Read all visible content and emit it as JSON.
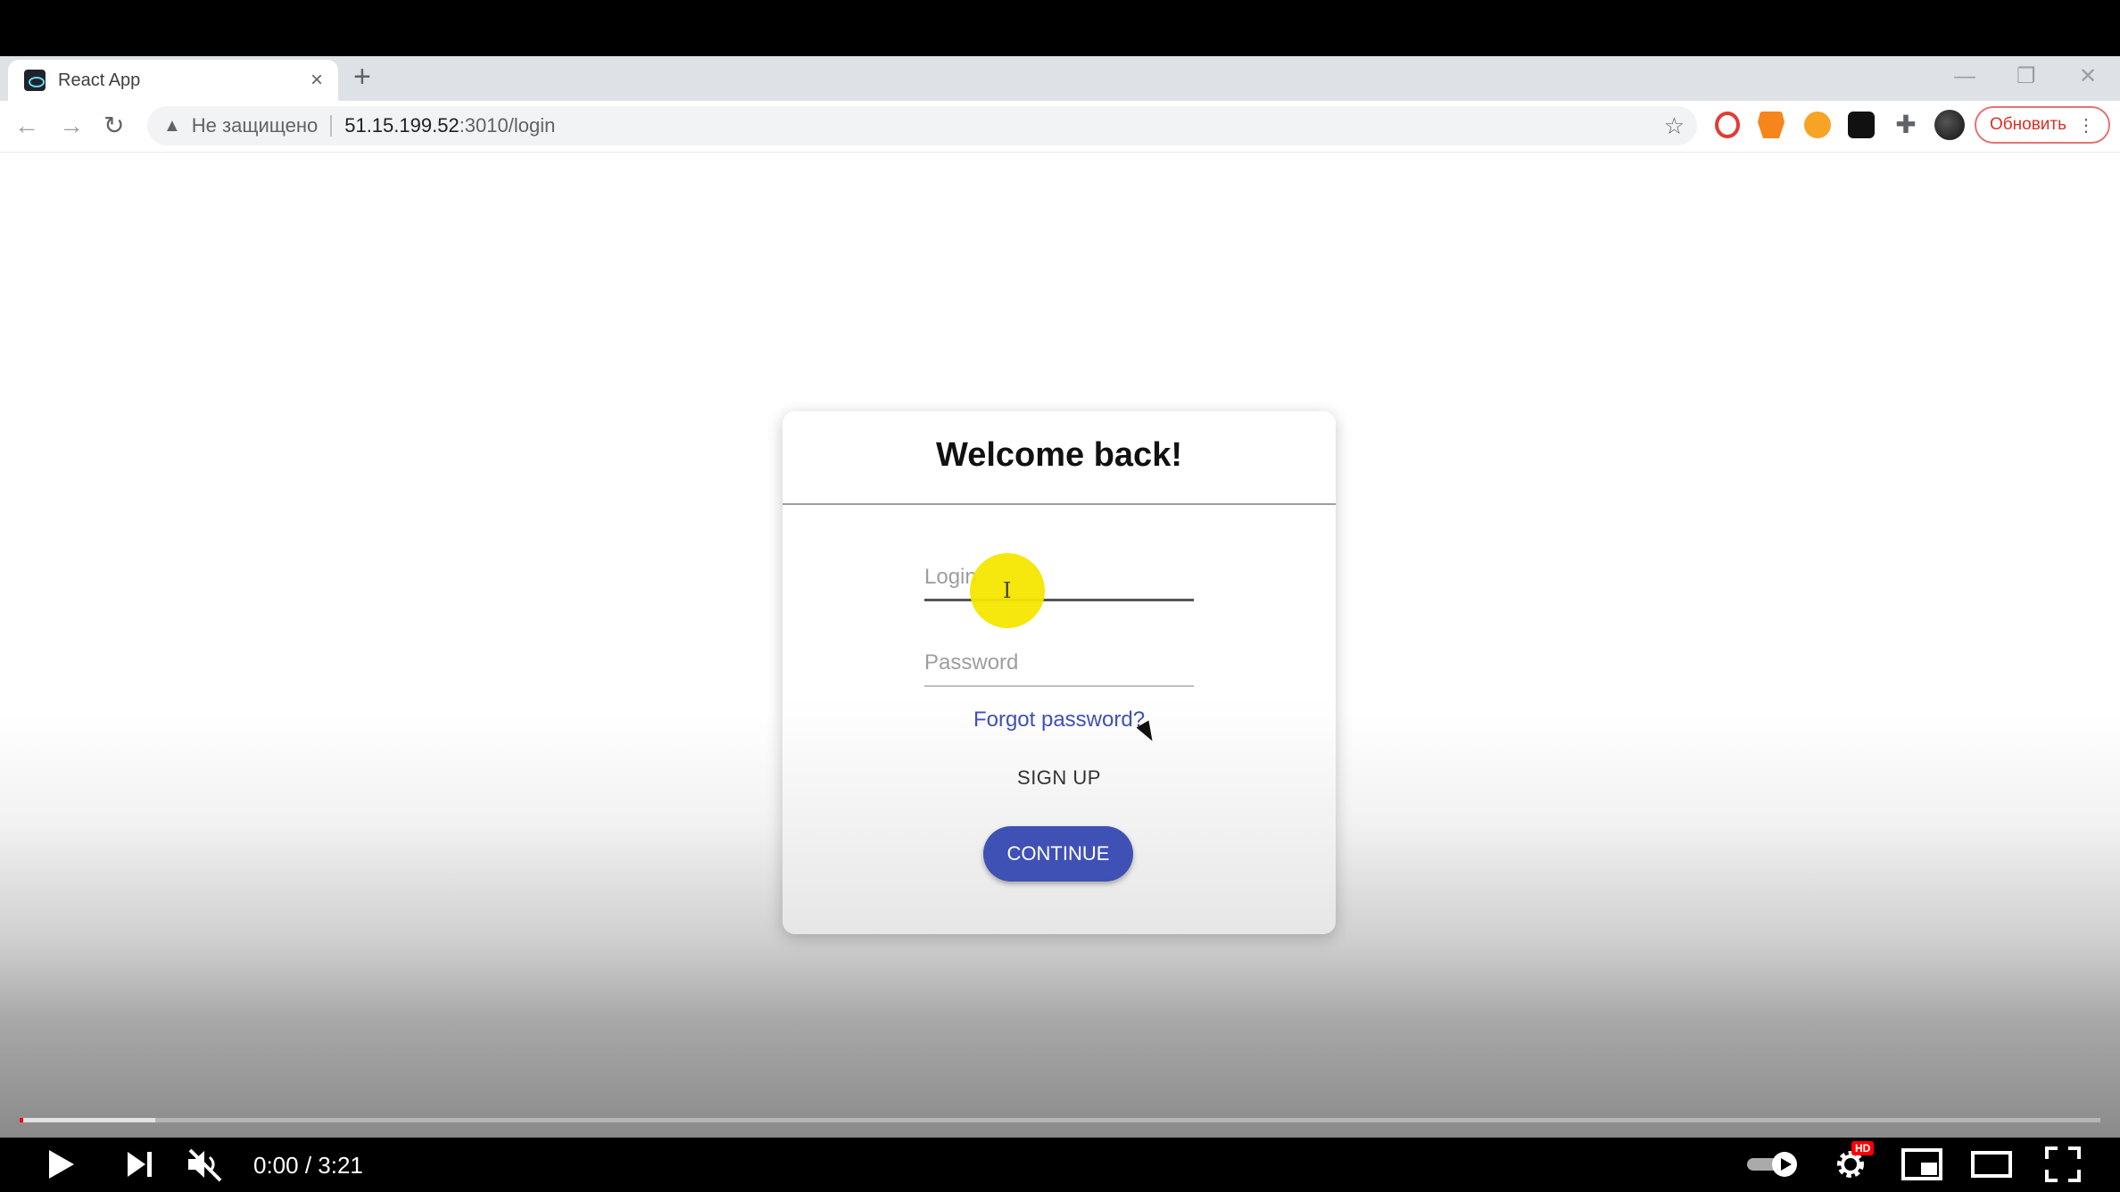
{
  "browser": {
    "tab_title": "React App",
    "tab_close": "×",
    "new_tab": "+",
    "security_label": "Не защищено",
    "url_host": "51.15.199.52",
    "url_path": ":3010/login",
    "update_button": "Обновить",
    "window_controls": {
      "minimize": "—",
      "restore": "❐",
      "close": "✕"
    },
    "nav": {
      "back": "←",
      "forward": "→",
      "reload": "↻"
    },
    "star": "☆"
  },
  "login_card": {
    "title": "Welcome back!",
    "login_placeholder": "Login",
    "password_placeholder": "Password",
    "forgot_link": "Forgot password?",
    "signup_label": "SIGN UP",
    "continue_label": "CONTINUE"
  },
  "video_player": {
    "time_display": "0:00 / 3:21",
    "progress_played_fraction": 0.0,
    "progress_buffered_fraction": 0.065,
    "hd_badge": "HD"
  },
  "colors": {
    "primary": "#3f51b5",
    "update_text": "#d93025",
    "highlight": "#f5e600",
    "youtube_red": "#ff0000"
  }
}
